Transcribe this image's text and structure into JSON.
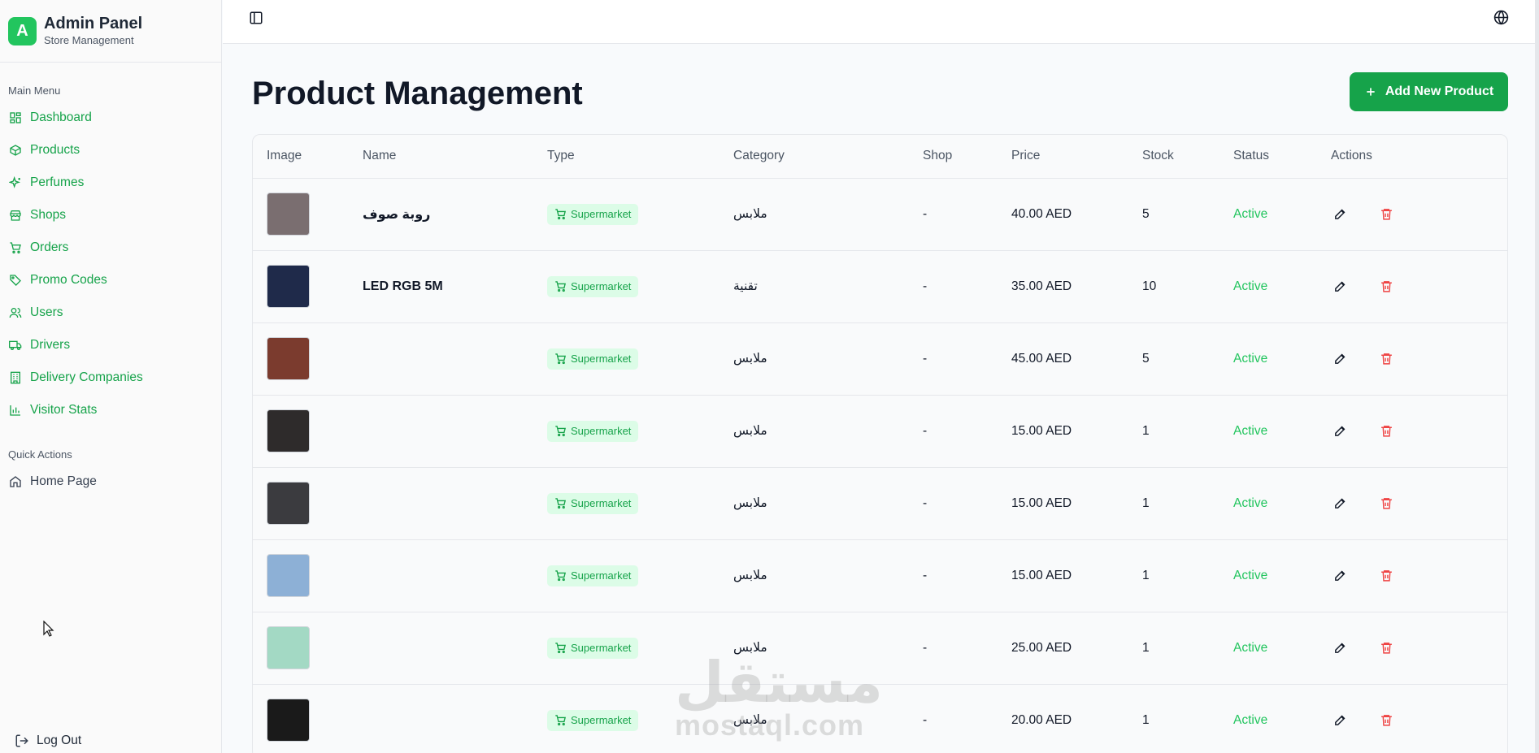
{
  "brand": {
    "logo_letter": "A",
    "title": "Admin Panel",
    "subtitle": "Store Management"
  },
  "sidebar": {
    "main_label": "Main Menu",
    "items": [
      {
        "label": "Dashboard",
        "icon": "dashboard-icon"
      },
      {
        "label": "Products",
        "icon": "box-icon"
      },
      {
        "label": "Perfumes",
        "icon": "sparkles-icon"
      },
      {
        "label": "Shops",
        "icon": "store-icon"
      },
      {
        "label": "Orders",
        "icon": "cart-icon"
      },
      {
        "label": "Promo Codes",
        "icon": "tag-icon"
      },
      {
        "label": "Users",
        "icon": "users-icon"
      },
      {
        "label": "Drivers",
        "icon": "truck-icon"
      },
      {
        "label": "Delivery Companies",
        "icon": "building-icon"
      },
      {
        "label": "Visitor Stats",
        "icon": "bar-chart-icon"
      }
    ],
    "quick_label": "Quick Actions",
    "quick_items": [
      {
        "label": "Home Page",
        "icon": "home-icon"
      }
    ],
    "logout_label": "Log Out"
  },
  "main": {
    "title": "Product Management",
    "add_button": "Add New Product"
  },
  "table": {
    "columns": [
      "Image",
      "Name",
      "Type",
      "Category",
      "Shop",
      "Price",
      "Stock",
      "Status",
      "Actions"
    ],
    "rows": [
      {
        "name": "روبة صوف",
        "type": "Supermarket",
        "category": "ملابس",
        "shop": "-",
        "price": "40.00 AED",
        "stock": "5",
        "status": "Active",
        "thumb": "#7a6e70"
      },
      {
        "name": "LED RGB 5M",
        "type": "Supermarket",
        "category": "تقنية",
        "shop": "-",
        "price": "35.00 AED",
        "stock": "10",
        "status": "Active",
        "thumb": "#1f2a4a"
      },
      {
        "name": "",
        "type": "Supermarket",
        "category": "ملابس",
        "shop": "-",
        "price": "45.00 AED",
        "stock": "5",
        "status": "Active",
        "thumb": "#7b3b2e"
      },
      {
        "name": "",
        "type": "Supermarket",
        "category": "ملابس",
        "shop": "-",
        "price": "15.00 AED",
        "stock": "1",
        "status": "Active",
        "thumb": "#2e2b2b"
      },
      {
        "name": "",
        "type": "Supermarket",
        "category": "ملابس",
        "shop": "-",
        "price": "15.00 AED",
        "stock": "1",
        "status": "Active",
        "thumb": "#3b3b3f"
      },
      {
        "name": "",
        "type": "Supermarket",
        "category": "ملابس",
        "shop": "-",
        "price": "15.00 AED",
        "stock": "1",
        "status": "Active",
        "thumb": "#8db0d6"
      },
      {
        "name": "",
        "type": "Supermarket",
        "category": "ملابس",
        "shop": "-",
        "price": "25.00 AED",
        "stock": "1",
        "status": "Active",
        "thumb": "#a3d9c4"
      },
      {
        "name": "",
        "type": "Supermarket",
        "category": "ملابس",
        "shop": "-",
        "price": "20.00 AED",
        "stock": "1",
        "status": "Active",
        "thumb": "#1a1a1a"
      }
    ]
  },
  "watermark": {
    "arabic": "مستقل",
    "latin": "mostaql.com"
  },
  "colors": {
    "accent": "#16a34a",
    "danger": "#ef4444"
  }
}
